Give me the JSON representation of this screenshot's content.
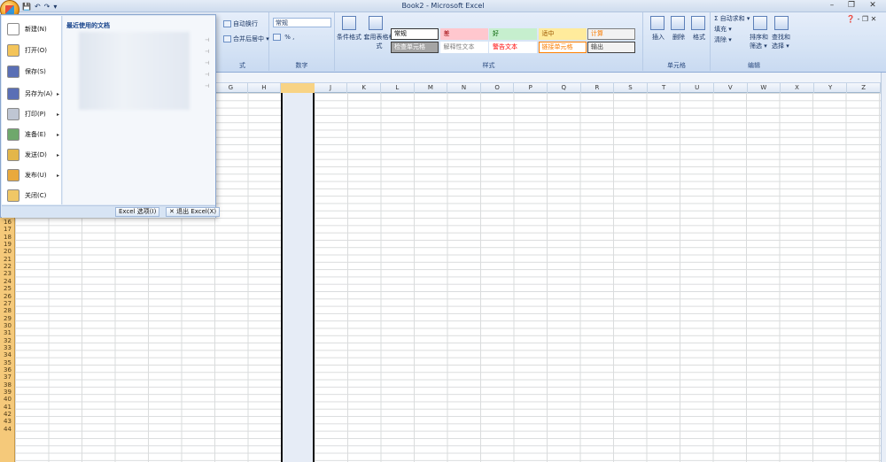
{
  "window": {
    "title": "Book2 - Microsoft Excel",
    "minimize": "–",
    "restore": "❐",
    "close": "✕"
  },
  "qat": {
    "save": "💾",
    "undo": "↶",
    "redo": "↷",
    "customize": "▾"
  },
  "ribbon": {
    "help": "❓ - ❐ ✕",
    "alignment": {
      "wrap": "自动换行",
      "merge": "合并后居中 ▾",
      "label": "式"
    },
    "number": {
      "format": "常规",
      "percent": "%",
      "comma": ",",
      "label": "数字"
    },
    "styles": {
      "conditional": "条件格式",
      "table": "套用表格格式",
      "label": "样式",
      "cells": [
        {
          "text": "常规",
          "bg": "#ffffff",
          "fg": "#000000",
          "border": "#333333"
        },
        {
          "text": "差",
          "bg": "#ffc7ce",
          "fg": "#9c0006",
          "border": "#ffc7ce"
        },
        {
          "text": "好",
          "bg": "#c6efce",
          "fg": "#006100",
          "border": "#c6efce"
        },
        {
          "text": "适中",
          "bg": "#ffeb9c",
          "fg": "#9c5700",
          "border": "#ffeb9c"
        },
        {
          "text": "计算",
          "bg": "#f2f2f2",
          "fg": "#fa7d00",
          "border": "#7f7f7f"
        },
        {
          "text": "检查单元格",
          "bg": "#a5a5a5",
          "fg": "#ffffff",
          "border": "#3f3f3f"
        },
        {
          "text": "解释性文本",
          "bg": "#ffffff",
          "fg": "#7f7f7f",
          "border": "#ffffff"
        },
        {
          "text": "警告文本",
          "bg": "#ffffff",
          "fg": "#ff0000",
          "border": "#ffffff"
        },
        {
          "text": "链接单元格",
          "bg": "#ffffff",
          "fg": "#fa7d00",
          "border": "#ff8001"
        },
        {
          "text": "输出",
          "bg": "#f2f2f2",
          "fg": "#3f3f3f",
          "border": "#3f3f3f"
        }
      ]
    },
    "cellsgroup": {
      "insert": "插入",
      "delete": "删除",
      "format": "格式",
      "label": "单元格"
    },
    "editing": {
      "autosum": "Σ 自动求和 ▾",
      "fill": "填充 ▾",
      "clear": "清除 ▾",
      "sort": "排序和筛选 ▾",
      "find": "查找和选择 ▾",
      "label": "编辑"
    }
  },
  "columns": [
    "G",
    "H",
    "I",
    "J",
    "K",
    "L",
    "M",
    "N",
    "O",
    "P",
    "Q",
    "R",
    "S",
    "T",
    "U",
    "V",
    "W",
    "X",
    "Y",
    "Z"
  ],
  "rows": [
    "16",
    "17",
    "18",
    "19",
    "20",
    "21",
    "22",
    "23",
    "24",
    "25",
    "26",
    "27",
    "28",
    "29",
    "30",
    "31",
    "32",
    "33",
    "34",
    "35",
    "36",
    "37",
    "38",
    "39",
    "40",
    "41",
    "42",
    "43",
    "44"
  ],
  "menu": {
    "items": [
      {
        "label": "新建(N)",
        "arrow": ""
      },
      {
        "label": "打开(O)",
        "arrow": ""
      },
      {
        "label": "保存(S)",
        "arrow": ""
      },
      {
        "label": "另存为(A)",
        "arrow": "▸"
      },
      {
        "label": "打印(P)",
        "arrow": "▸"
      },
      {
        "label": "准备(E)",
        "arrow": "▸"
      },
      {
        "label": "发送(D)",
        "arrow": "▸"
      },
      {
        "label": "发布(U)",
        "arrow": "▸"
      },
      {
        "label": "关闭(C)",
        "arrow": ""
      }
    ],
    "recent_title": "最近使用的文档",
    "options_button": "Excel 选项(I)",
    "exit_button": "✕ 退出 Excel(X)"
  }
}
